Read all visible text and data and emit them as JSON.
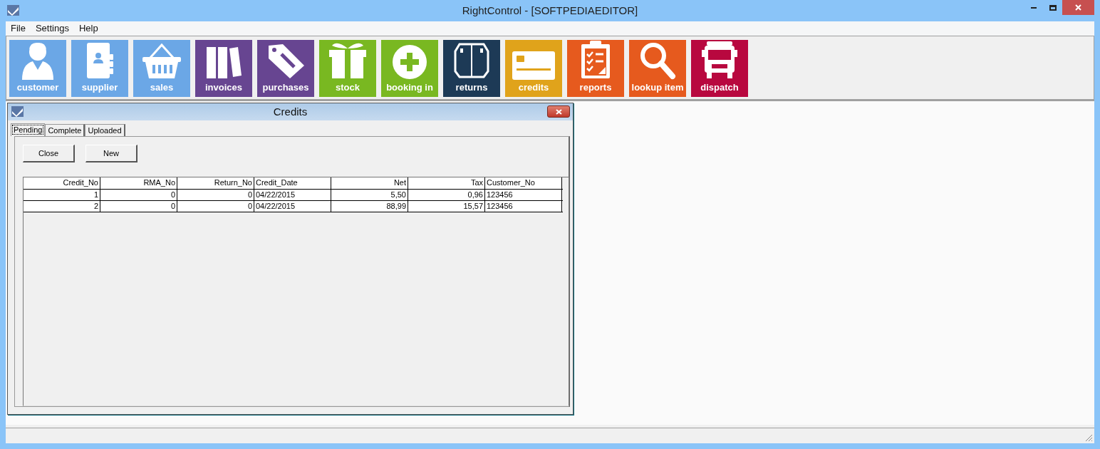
{
  "window": {
    "title": "RightControl - [SOFTPEDIAEDITOR]"
  },
  "menu": [
    "File",
    "Settings",
    "Help"
  ],
  "toolbar": [
    {
      "label": "customer",
      "kind": "person",
      "color": "#6ba7e6"
    },
    {
      "label": "supplier",
      "kind": "contact-book",
      "color": "#6ba7e6"
    },
    {
      "label": "sales",
      "kind": "basket",
      "color": "#6ba7e6"
    },
    {
      "label": "invoices",
      "kind": "books",
      "color": "#674591"
    },
    {
      "label": "purchases",
      "kind": "tag",
      "color": "#674591"
    },
    {
      "label": "stock",
      "kind": "gift",
      "color": "#79b821"
    },
    {
      "label": "booking in",
      "kind": "plus",
      "color": "#79b821"
    },
    {
      "label": "returns",
      "kind": "box",
      "color": "#1d3a56"
    },
    {
      "label": "credits",
      "kind": "card",
      "color": "#e0a31b"
    },
    {
      "label": "reports",
      "kind": "clipboard",
      "color": "#e65a1e"
    },
    {
      "label": "lookup item",
      "kind": "magnifier",
      "color": "#e65a1e"
    },
    {
      "label": "dispatch",
      "kind": "truck",
      "color": "#b8083f"
    }
  ],
  "child_window": {
    "title": "Credits",
    "tabs": [
      {
        "label": "Pending",
        "selected": true
      },
      {
        "label": "Complete",
        "selected": false
      },
      {
        "label": "Uploaded",
        "selected": false
      }
    ],
    "buttons": [
      "Close",
      "New"
    ],
    "table": {
      "columns": [
        {
          "label": "Credit_No",
          "kind": "number"
        },
        {
          "label": "RMA_No",
          "kind": "number"
        },
        {
          "label": "Return_No",
          "kind": "number"
        },
        {
          "label": "Credit_Date",
          "kind": "text"
        },
        {
          "label": "Net",
          "kind": "number"
        },
        {
          "label": "Tax",
          "kind": "number"
        },
        {
          "label": "Customer_No",
          "kind": "text"
        }
      ],
      "rows": [
        [
          "1",
          "0",
          "0",
          "04/22/2015",
          "5,50",
          "0,96",
          "123456"
        ],
        [
          "2",
          "0",
          "0",
          "04/22/2015",
          "88,99",
          "15,57",
          "123456"
        ]
      ]
    }
  }
}
